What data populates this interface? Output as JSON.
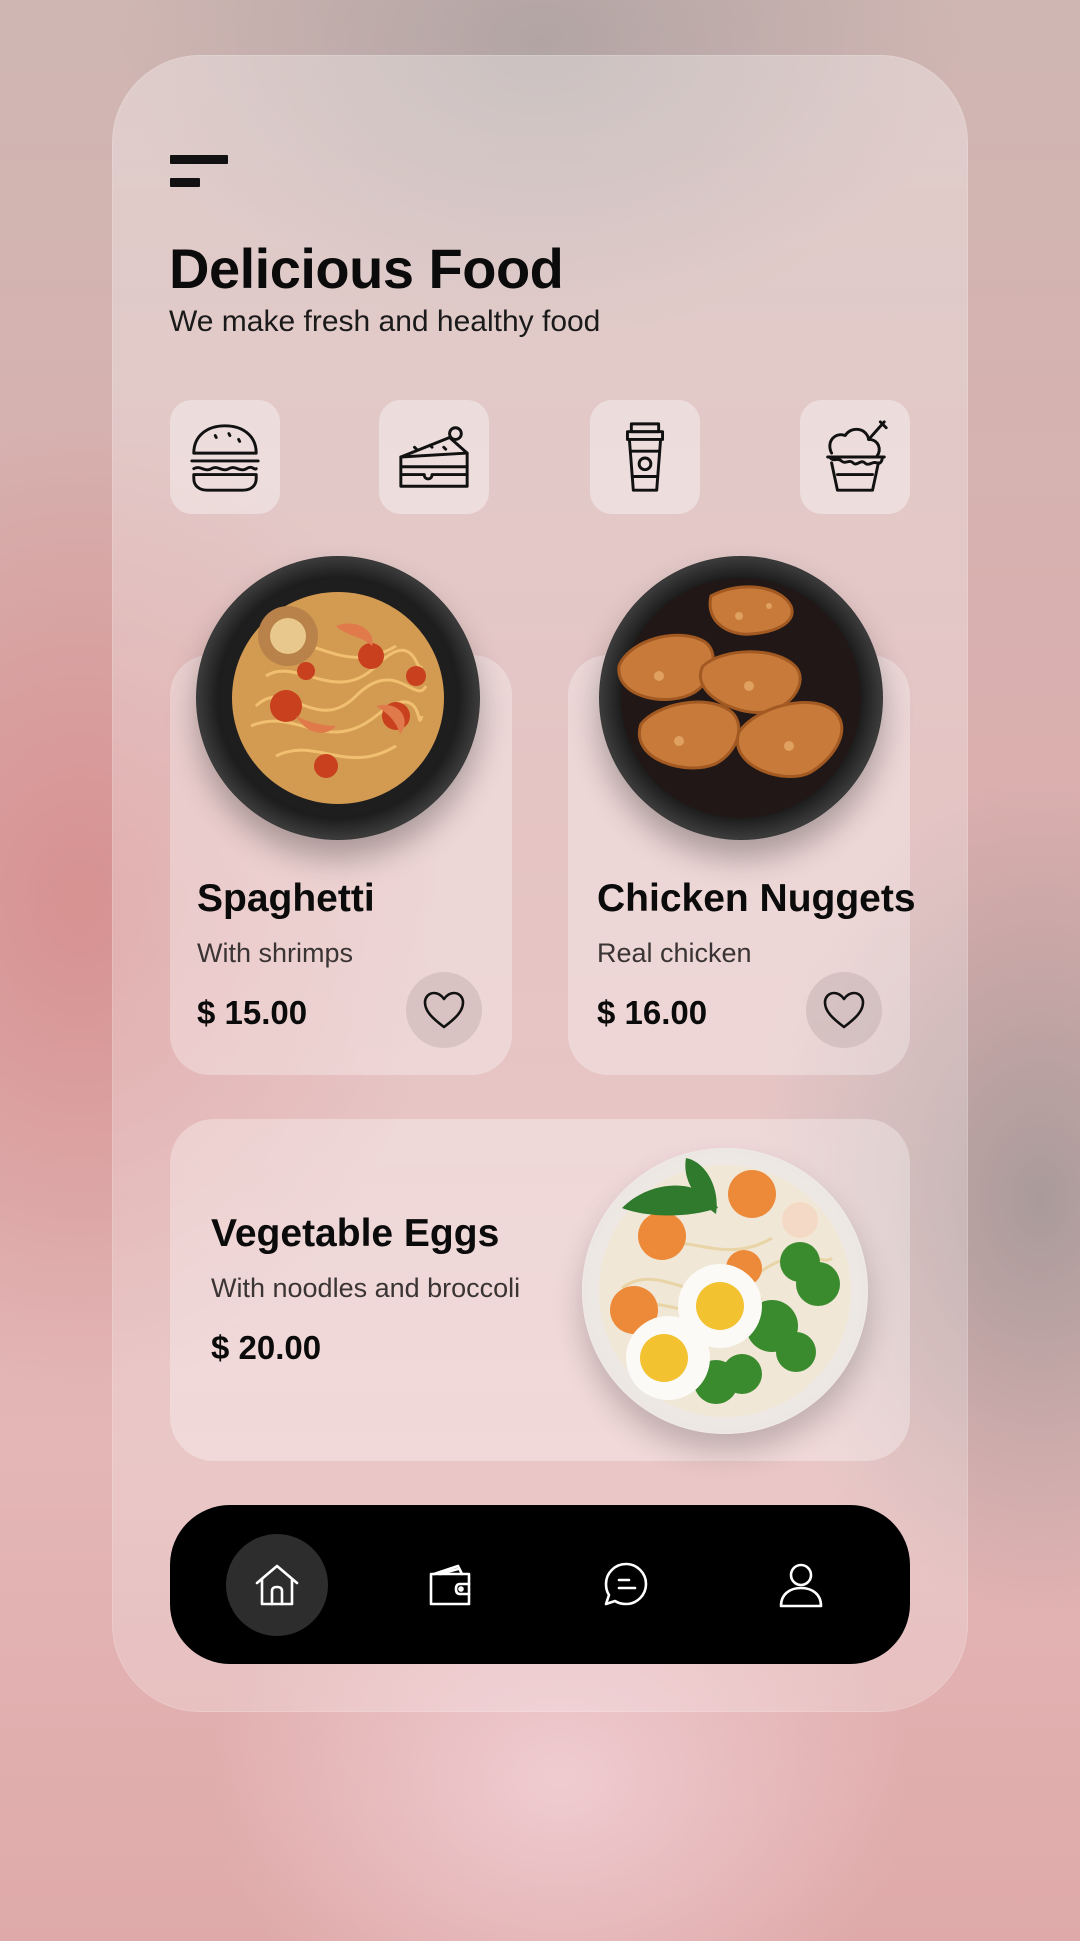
{
  "header": {
    "title": "Delicious Food",
    "subtitle": "We make fresh and healthy food"
  },
  "categories": [
    {
      "icon": "burger-icon"
    },
    {
      "icon": "cake-slice-icon"
    },
    {
      "icon": "coffee-cup-icon"
    },
    {
      "icon": "ice-cream-icon"
    }
  ],
  "items": [
    {
      "name": "Spaghetti",
      "description": "With shrimps",
      "price": "$ 15.00",
      "favorite_icon": "heart-icon"
    },
    {
      "name": "Chicken Nuggets",
      "description": "Real chicken",
      "price": "$ 16.00",
      "favorite_icon": "heart-icon"
    }
  ],
  "featured": {
    "name": "Vegetable Eggs",
    "description": "With noodles and broccoli",
    "price": "$ 20.00"
  },
  "nav": [
    {
      "icon": "home-icon",
      "active": true
    },
    {
      "icon": "wallet-icon",
      "active": false
    },
    {
      "icon": "chat-icon",
      "active": false
    },
    {
      "icon": "user-icon",
      "active": false
    }
  ],
  "colors": {
    "nav_background": "#000000",
    "nav_active": "#2d2d2d",
    "text": "#0b0b0b"
  }
}
